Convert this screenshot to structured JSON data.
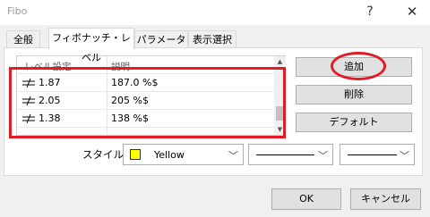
{
  "window": {
    "title": "Fibo",
    "help_glyph": "?",
    "close_glyph": "✕"
  },
  "tabs": [
    {
      "label": "全般"
    },
    {
      "label": "フィボナッチ・レベル"
    },
    {
      "label": "パラメーター"
    },
    {
      "label": "表示選択"
    }
  ],
  "active_tab": 1,
  "levels": {
    "headers": {
      "level": "レベル設定",
      "description": "説明"
    },
    "rows": [
      {
        "level": "1.87",
        "description": "187.0 %$"
      },
      {
        "level": "2.05",
        "description": "205 %$"
      },
      {
        "level": "1.38",
        "description": "138 %$"
      }
    ]
  },
  "side_buttons": {
    "add": "追加",
    "delete": "削除",
    "default": "デフォルト"
  },
  "style": {
    "label": "スタイル",
    "color_name": "Yellow",
    "color_hex": "#ffff00",
    "dropdown_arrow": "﹀"
  },
  "footer": {
    "ok": "OK",
    "cancel": "キャンセル"
  },
  "annotation_color": "#e31c23"
}
